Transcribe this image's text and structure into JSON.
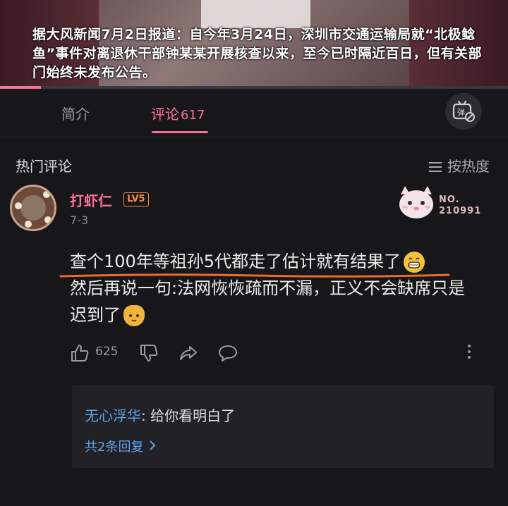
{
  "video": {
    "caption": "据大风新闻7月2日报道：自今年3月24日，深圳市交通运输局就“北极鲶鱼”事件对离退休干部钟某某开展核查以来，至今已时隔近百日，但有关部门始终未发布公告。",
    "progress": 0.08
  },
  "tabs": {
    "intro": "简介",
    "comments": "评论",
    "comments_count": "617"
  },
  "section": {
    "title": "热门评论",
    "sort_label": "按热度"
  },
  "comment": {
    "username": "打虾仁",
    "level": "LV5",
    "date": "7-3",
    "badge_no_label": "NO.",
    "badge_no_value": "210991",
    "text_line1": "查个100年等祖孙5代都走了估计就有结果了",
    "text_line2": "然后再说一句:法网恢恢疏而不漏，正义不会缺席只是迟到了",
    "like_count": "625"
  },
  "reply": {
    "user": "无心浮华",
    "separator": ": ",
    "text": "给你看明白了",
    "more": "共2条回复"
  },
  "colors": {
    "accent": "#fb7299",
    "link": "#5aa3ee",
    "level": "#ff8a3d"
  },
  "icons": [
    "danmaku-off-icon",
    "sort-icon",
    "like-icon",
    "dislike-icon",
    "share-icon",
    "reply-icon",
    "more-icon",
    "chevron-right-icon"
  ]
}
